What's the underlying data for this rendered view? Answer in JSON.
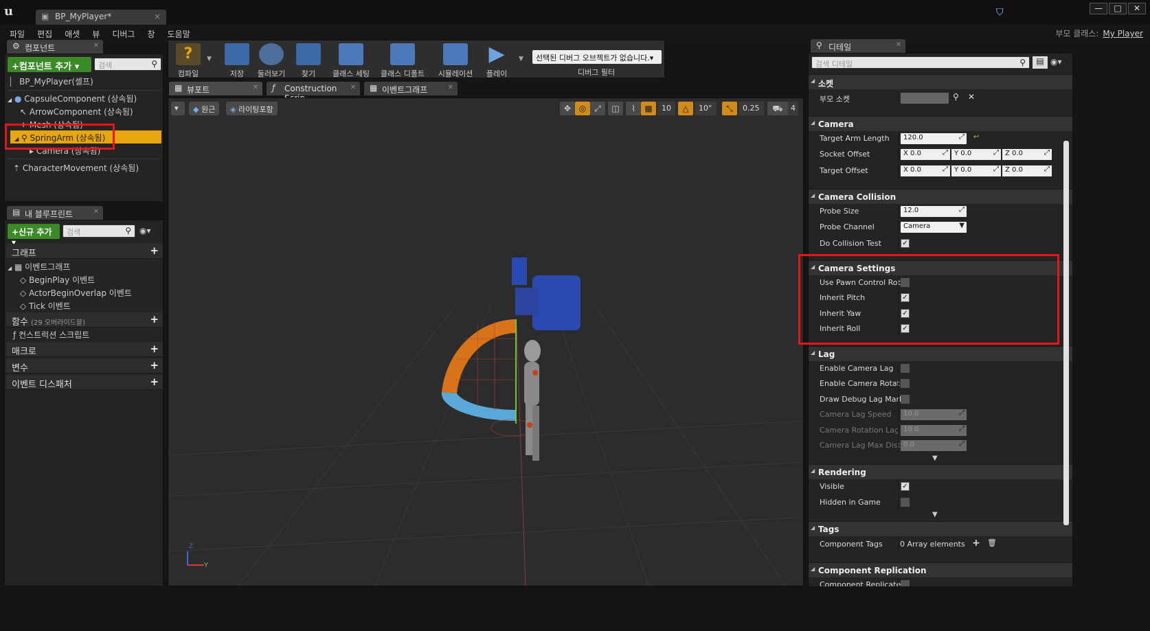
{
  "window": {
    "logo": "u",
    "doc_tab": "BP_MyPlayer*",
    "close": "×",
    "controls": [
      "—",
      "□",
      "✕"
    ]
  },
  "menu": [
    "파일",
    "편집",
    "애셋",
    "뷰",
    "디버그",
    "창",
    "도움말"
  ],
  "parent_class": {
    "label": "부모 클래스:",
    "value": "My Player"
  },
  "components": {
    "tab": "컴포넌트",
    "add_button": "+컴포넌트 추가 ▾",
    "search_placeholder": "검색",
    "self": "BP_MyPlayer(셀프)",
    "items": [
      "CapsuleComponent (상속됨)",
      "ArrowComponent (상속됨)",
      "Mesh (상속됨)",
      "SpringArm (상속됨)",
      "Camera (상속됨)",
      "CharacterMovement (상속됨)"
    ]
  },
  "my_blueprint": {
    "tab": "내 블루프린트",
    "add_button": "+신규 추가 ▾",
    "search_placeholder": "검색",
    "graphs_label": "그래프",
    "event_graph": "이벤트그래프",
    "events": [
      "BeginPlay 이벤트",
      "ActorBeginOverlap 이벤트",
      "Tick 이벤트"
    ],
    "functions_label": "함수",
    "functions_count": "(29 오버라이드블)",
    "construction_script": "컨스트럭션 스크립트",
    "macros": "매크로",
    "variables": "변수",
    "dispatchers": "이벤트 디스패처"
  },
  "toolbar": {
    "buttons": [
      "컴파일",
      "저장",
      "둘러보기",
      "찾기",
      "클래스 세팅",
      "클래스 디폴트",
      "시뮬레이션",
      "플레이"
    ],
    "debug_dropdown": "선택된 디버그 오브젝트가 없습니다.▾",
    "debug_filter": "디버그 필터"
  },
  "editor_tabs": [
    "뷰포트",
    "Construction Scrip",
    "이벤트그래프"
  ],
  "viewport": {
    "perspective": "원근",
    "lighting": "라이팅포함",
    "grid_snap": "10",
    "rot_snap": "10°",
    "scale_snap": "0.25",
    "cam_speed": "4",
    "axis_y": "Y",
    "axis_z": "Z"
  },
  "details": {
    "tab": "디테일",
    "search_placeholder": "검색 디테일",
    "sections": {
      "socket": {
        "title": "소켓",
        "parent_socket": "부모 소켓"
      },
      "camera": {
        "title": "Camera",
        "target_arm_length_label": "Target Arm Length",
        "target_arm_length": "120.0",
        "socket_offset_label": "Socket Offset",
        "target_offset_label": "Target Offset",
        "x": "X",
        "y": "Y",
        "z": "Z",
        "zero": "0.0"
      },
      "collision": {
        "title": "Camera Collision",
        "probe_size_label": "Probe Size",
        "probe_size": "12.0",
        "probe_channel_label": "Probe Channel",
        "probe_channel": "Camera",
        "do_collision_label": "Do Collision Test"
      },
      "settings": {
        "title": "Camera Settings",
        "rows": [
          "Use Pawn Control Rotati",
          "Inherit Pitch",
          "Inherit Yaw",
          "Inherit Roll"
        ]
      },
      "lag": {
        "title": "Lag",
        "rows": [
          "Enable Camera Lag",
          "Enable Camera Rotation",
          "Draw Debug Lag Markers"
        ],
        "disabled_rows": [
          "Camera Lag Speed",
          "Camera Rotation Lag Sp",
          "Camera Lag Max Distan"
        ],
        "disabled_values": [
          "10.0",
          "10.0",
          "0.0"
        ]
      },
      "rendering": {
        "title": "Rendering",
        "visible": "Visible",
        "hidden_in_game": "Hidden in Game"
      },
      "tags": {
        "title": "Tags",
        "component_tags": "Component Tags",
        "array": "0 Array elements"
      },
      "replication": {
        "title": "Component Replication",
        "replicates": "Component Replicates"
      }
    }
  },
  "colors": {
    "accent": "#e8a60e",
    "highlight": "#e8151b",
    "green": "#3a8a28"
  }
}
